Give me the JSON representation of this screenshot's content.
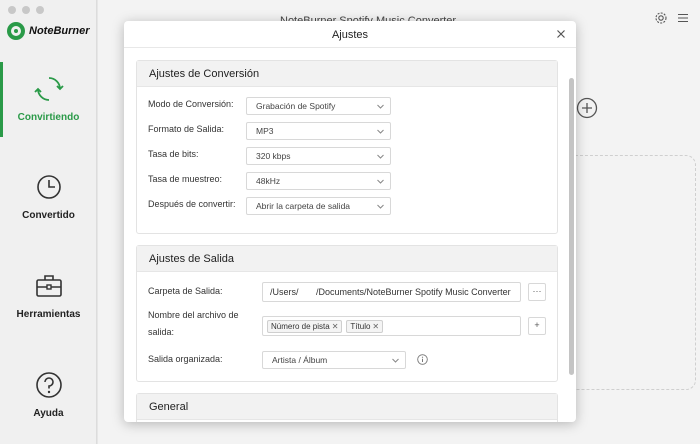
{
  "app": {
    "brand": "NoteBurner",
    "window_title": "NoteBurner Spotify Music Converter"
  },
  "sidebar": {
    "items": [
      {
        "label": "Convirtiendo",
        "icon": "refresh-icon",
        "active": true
      },
      {
        "label": "Convertido",
        "icon": "clock-icon",
        "active": false
      },
      {
        "label": "Herramientas",
        "icon": "toolbox-icon",
        "active": false
      },
      {
        "label": "Ayuda",
        "icon": "help-icon",
        "active": false
      }
    ]
  },
  "modal": {
    "title": "Ajustes",
    "sections": {
      "conversion": {
        "title": "Ajustes de Conversión",
        "rows": [
          {
            "label": "Modo de Conversión:",
            "value": "Grabación de Spotify"
          },
          {
            "label": "Formato de Salida:",
            "value": "MP3"
          },
          {
            "label": "Tasa de bits:",
            "value": "320 kbps"
          },
          {
            "label": "Tasa de muestreo:",
            "value": "48kHz"
          },
          {
            "label": "Después de convertir:",
            "value": "Abrir la carpeta de salida"
          }
        ]
      },
      "output": {
        "title": "Ajustes de Salida",
        "folder_label": "Carpeta de Salida:",
        "folder_value": "/Users/       /Documents/NoteBurner Spotify Music Converter",
        "folder_button": "···",
        "filename_label_line1": "Nombre del archivo de",
        "filename_label_line2": "salida:",
        "filename_tags": [
          "Número de pista",
          "Título"
        ],
        "add_tag_button": "+",
        "organized_label": "Salida organizada:",
        "organized_value": "Artista / Álbum"
      },
      "general": {
        "title": "General"
      }
    }
  },
  "colors": {
    "accent": "#2a9a48"
  }
}
